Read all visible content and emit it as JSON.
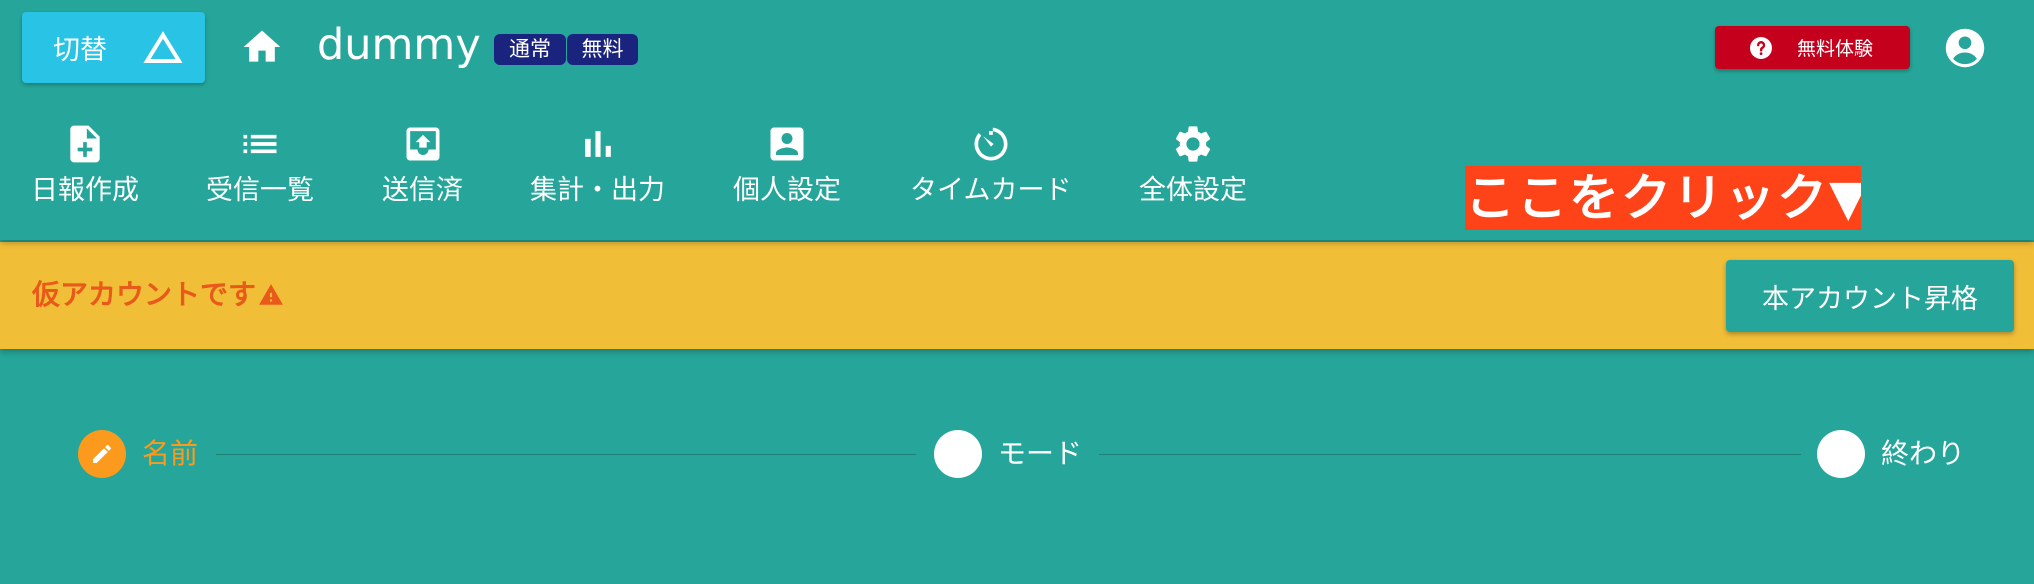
{
  "header": {
    "switch_label": "切替",
    "app_title": "dummy",
    "badges": [
      "通常",
      "無料"
    ],
    "trial_label": "無料体験"
  },
  "nav": [
    {
      "label": "日報作成",
      "icon": "note-add-icon"
    },
    {
      "label": "受信一覧",
      "icon": "list-icon"
    },
    {
      "label": "送信済",
      "icon": "outbox-icon"
    },
    {
      "label": "集計・出力",
      "icon": "bar-chart-icon"
    },
    {
      "label": "個人設定",
      "icon": "account-box-icon"
    },
    {
      "label": "タイムカード",
      "icon": "timer-icon"
    },
    {
      "label": "全体設定",
      "icon": "gear-icon"
    }
  ],
  "callout": "ここをクリック▼",
  "banner": {
    "warning_text": "仮アカウントです",
    "upgrade_label": "本アカウント昇格"
  },
  "stepper": {
    "steps": [
      {
        "label": "名前",
        "state": "active"
      },
      {
        "label": "モード",
        "state": "inactive"
      },
      {
        "label": "終わり",
        "state": "inactive"
      }
    ]
  },
  "colors": {
    "primary": "#26a69a",
    "switch_button": "#29c3e6",
    "badge": "#1a237e",
    "trial_button": "#c4001d",
    "callout": "#ff4319",
    "warning_band": "#f1be38",
    "warning_text": "#e8591a",
    "active_step": "#fb9a1c"
  }
}
